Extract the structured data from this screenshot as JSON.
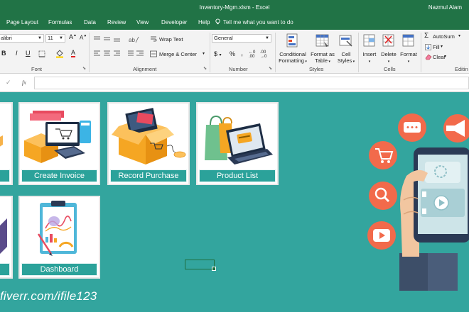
{
  "window": {
    "title": "Inventory-Mgm.xlsm  -  Excel",
    "user": "Nazmul Alam"
  },
  "tabs": [
    {
      "label": "Page Layout"
    },
    {
      "label": "Formulas"
    },
    {
      "label": "Data"
    },
    {
      "label": "Review"
    },
    {
      "label": "View"
    },
    {
      "label": "Developer"
    },
    {
      "label": "Help"
    }
  ],
  "tell_me": "Tell me what you want to do",
  "ribbon": {
    "font": {
      "name": "alibri",
      "size": "11",
      "group_label": "Font"
    },
    "alignment": {
      "wrap_text": "Wrap Text",
      "merge_center": "Merge & Center",
      "group_label": "Alignment"
    },
    "number": {
      "format": "General",
      "group_label": "Number"
    },
    "styles": {
      "conditional": "Conditional",
      "conditional2": "Formatting",
      "format_as": "Format as",
      "format_as2": "Table",
      "cell": "Cell",
      "cell2": "Styles",
      "group_label": "Styles"
    },
    "cells": {
      "insert": "Insert",
      "delete": "Delete",
      "format": "Format",
      "group_label": "Cells"
    },
    "editing": {
      "autosum": "AutoSum",
      "fill": "Fill",
      "clear": "Clear",
      "group_label": "Editin"
    }
  },
  "formula_bar": {
    "fx": "fx"
  },
  "dashboard_buttons": {
    "create_invoice": "Create Invoice",
    "record_purchase": "Record Purchase",
    "product_list": "Product List",
    "dashboard": "Dashboard"
  },
  "watermark": "fiverr.com/ifile123",
  "colors": {
    "excel_green": "#217346",
    "sheet_teal": "#33a59e",
    "button_teal": "#2ba29a",
    "accent_orange": "#f26a4b"
  }
}
